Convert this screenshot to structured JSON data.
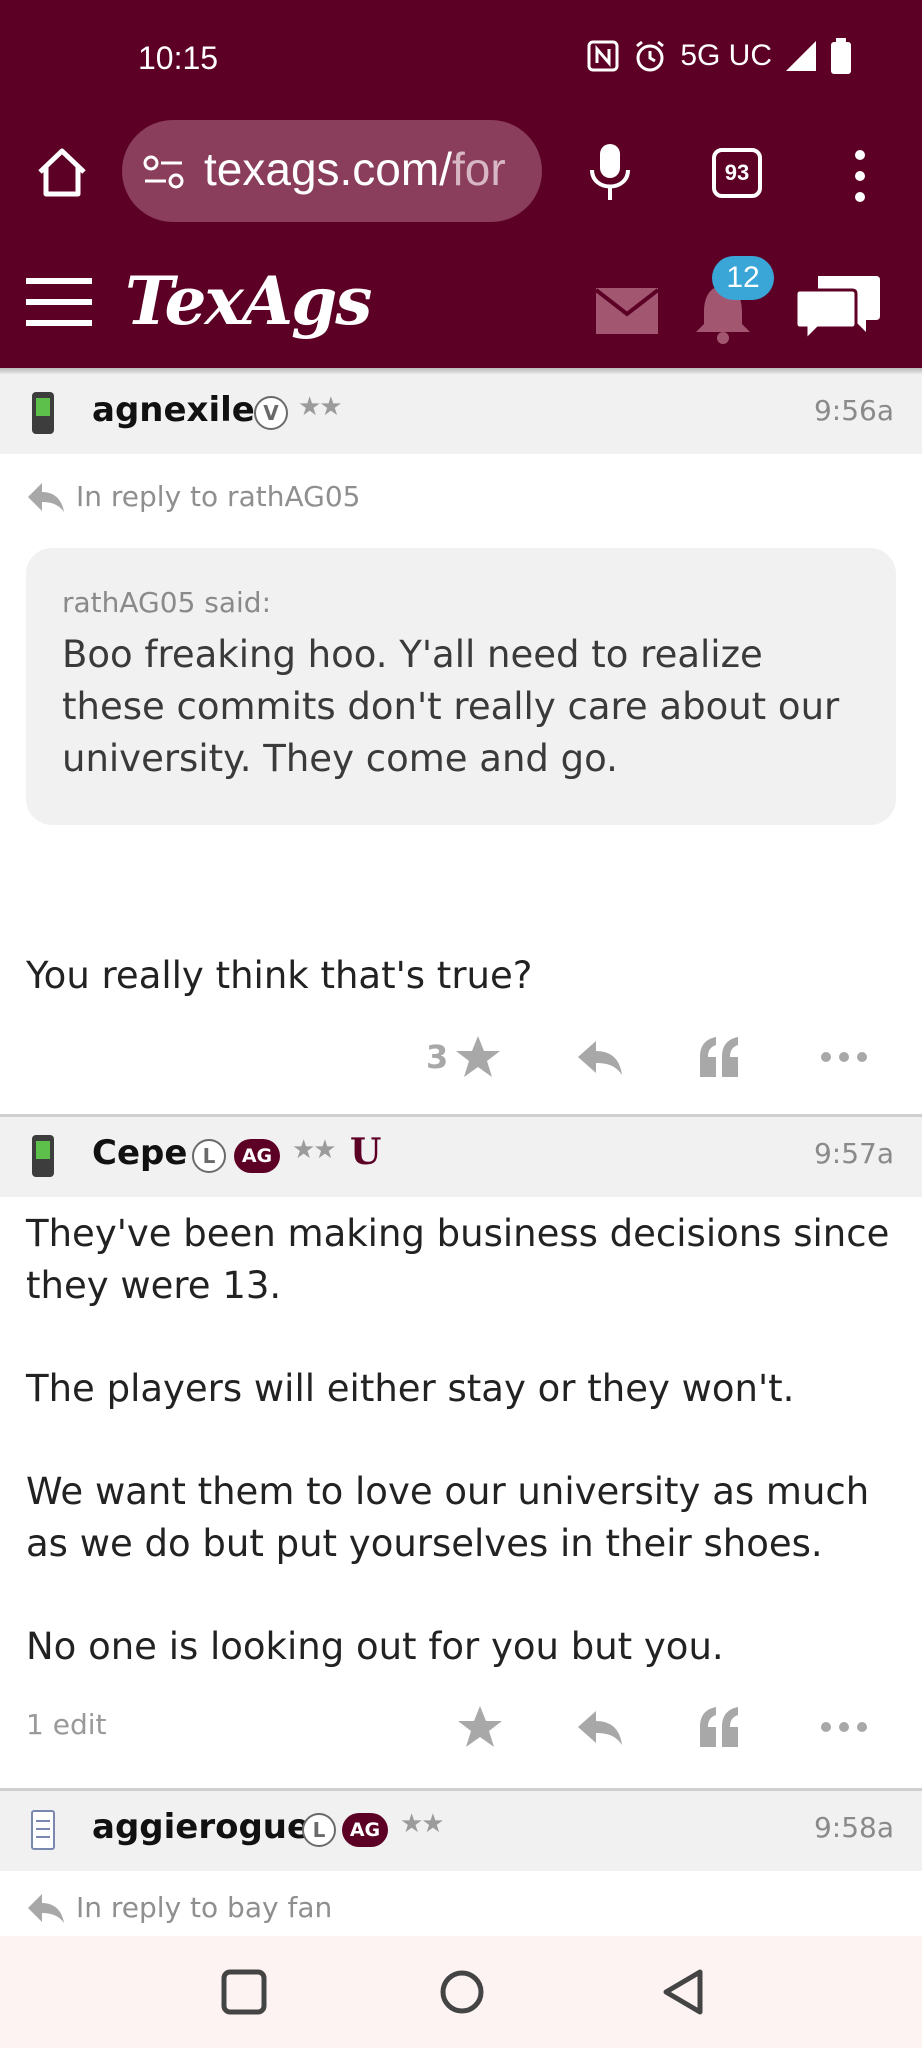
{
  "status_bar": {
    "time": "10:15",
    "network": "5G UC",
    "icons": [
      "nfc-icon",
      "alarm-icon",
      "signal-icon",
      "battery-icon"
    ]
  },
  "browser": {
    "url_visible": "texags.com/",
    "url_faded": "for",
    "tab_count": "93",
    "icons": [
      "home-icon",
      "site-settings-icon",
      "microphone-icon",
      "tabs-icon",
      "more-vert-icon"
    ]
  },
  "site_header": {
    "logo": "TexAgs",
    "notification_count": "12",
    "icons": [
      "menu-icon",
      "mail-icon",
      "bell-icon",
      "chat-icon"
    ],
    "colors": {
      "brand": "#5c0025",
      "badge": "#3aa6d8"
    }
  },
  "posts": [
    {
      "username": "agnexile",
      "badges": [
        "V"
      ],
      "stars": "★★",
      "time": "9:56a",
      "reply_to": "In reply to rathAG05",
      "quote": {
        "said": "rathAG05 said:",
        "text": "Boo freaking hoo. Y'all need to realize these commits don't really care about our university. They come and go."
      },
      "body": [
        "You really think that's true?"
      ],
      "like_count": "3"
    },
    {
      "username": "Cepe",
      "badges": [
        "L",
        "AG"
      ],
      "stars": "★★",
      "extra_badge": "U",
      "time": "9:57a",
      "body": [
        "They've been making business decisions since they were 13.",
        "The players will either stay or they won't.",
        "We want them to love our university as much as we do but put yourselves in their shoes.",
        "No one is looking out for you but you."
      ],
      "edit_note": "1 edit"
    },
    {
      "username": "aggierogue",
      "badges": [
        "L",
        "AG"
      ],
      "stars": "★★",
      "time": "9:58a",
      "reply_to": "In reply to bay fan"
    }
  ],
  "bottom_nav": {
    "icons": [
      "recents-icon",
      "home-circle-icon",
      "back-icon"
    ]
  }
}
